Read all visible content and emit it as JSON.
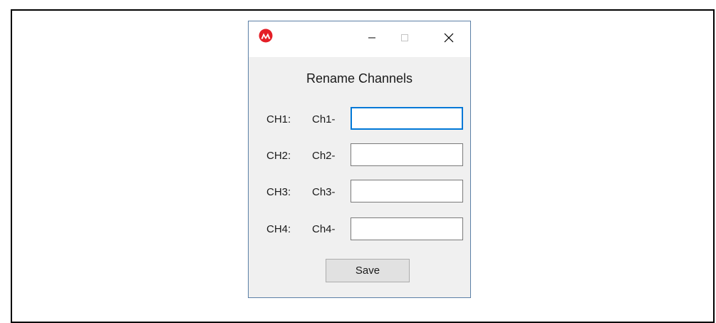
{
  "window": {
    "app_icon": "microchip-logo-icon",
    "controls": {
      "minimize_icon": "minimize-icon",
      "maximize_icon": "maximize-icon",
      "close_icon": "close-icon"
    }
  },
  "dialog": {
    "title": "Rename Channels",
    "channels": [
      {
        "label": "CH1:",
        "prefix": "Ch1-",
        "value": "",
        "focused": true
      },
      {
        "label": "CH2:",
        "prefix": "Ch2-",
        "value": "",
        "focused": false
      },
      {
        "label": "CH3:",
        "prefix": "Ch3-",
        "value": "",
        "focused": false
      },
      {
        "label": "CH4:",
        "prefix": "Ch4-",
        "value": "",
        "focused": false
      }
    ],
    "save_label": "Save"
  },
  "colors": {
    "accent_focus": "#0078d7",
    "logo_red": "#e41e26",
    "dialog_bg": "#f0f0f0"
  }
}
